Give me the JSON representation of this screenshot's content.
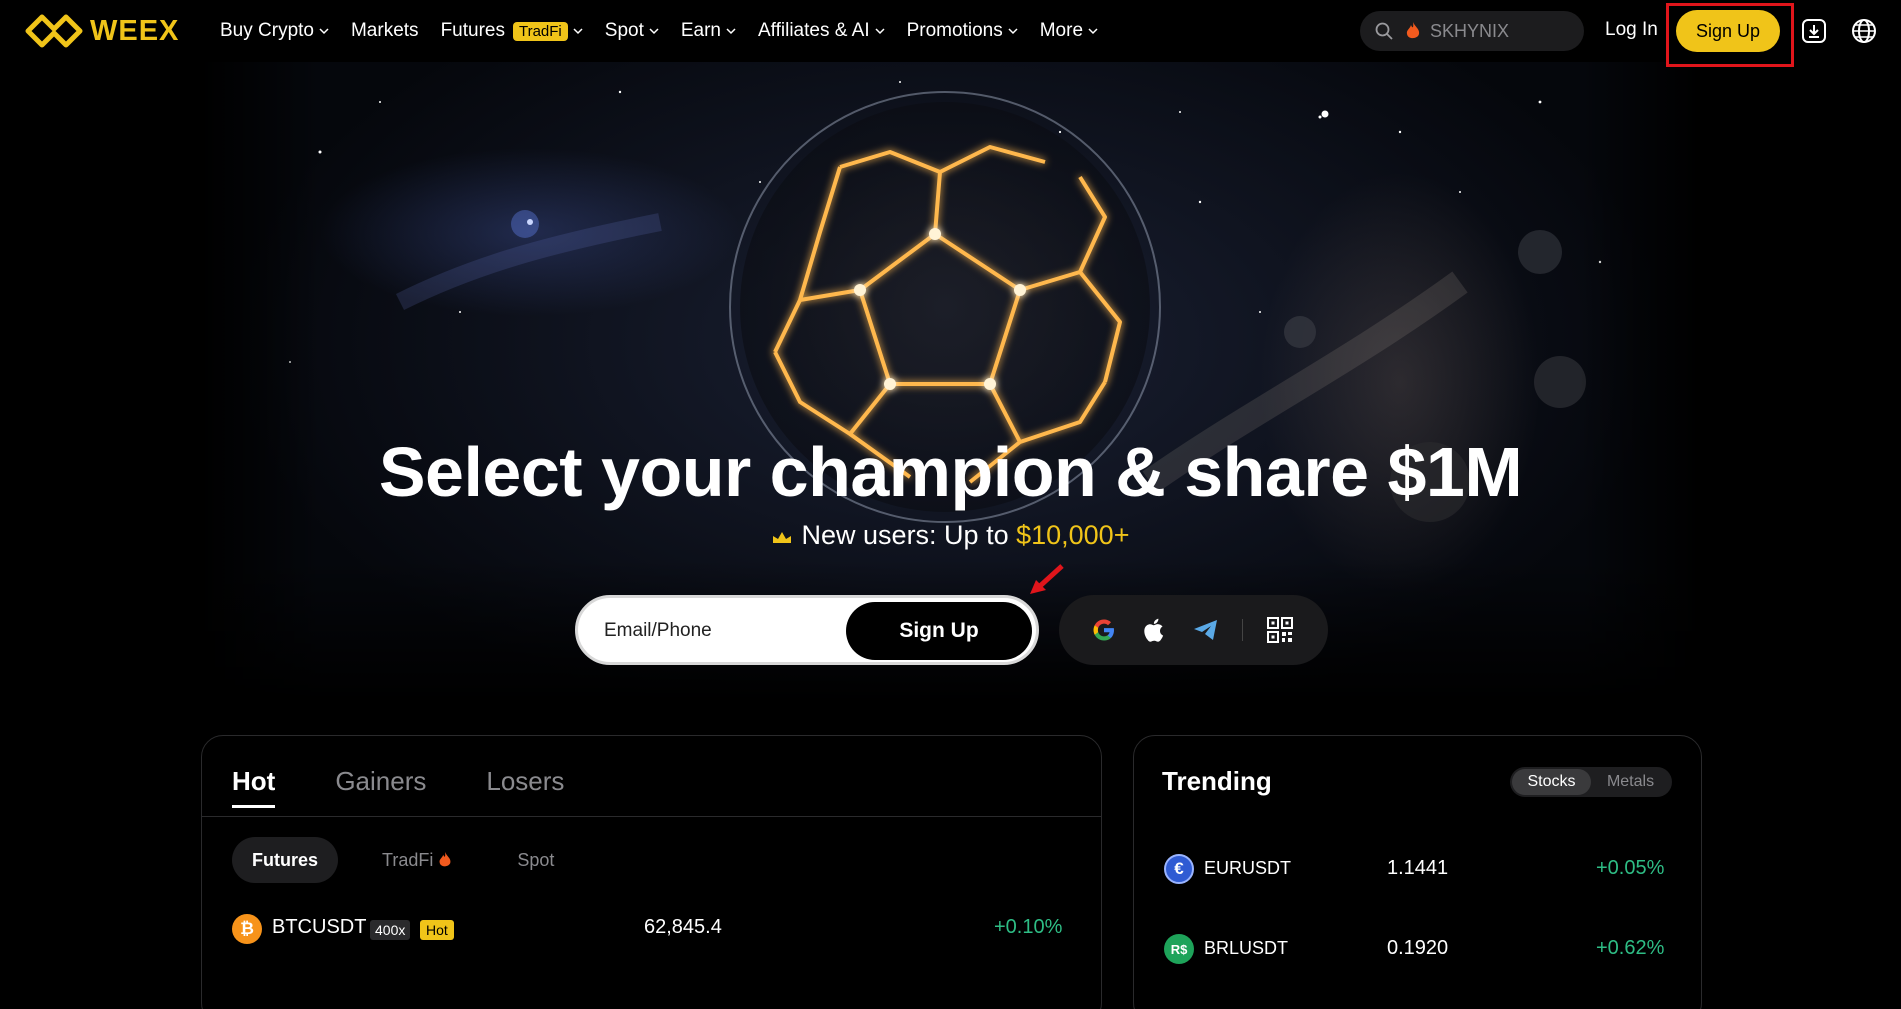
{
  "brand": {
    "name": "WEEX"
  },
  "nav": {
    "items": [
      {
        "label": "Buy Crypto",
        "dropdown": true
      },
      {
        "label": "Markets",
        "dropdown": false
      },
      {
        "label": "Futures",
        "badge": "TradFi",
        "dropdown": true
      },
      {
        "label": "Spot",
        "dropdown": true
      },
      {
        "label": "Earn",
        "dropdown": true
      },
      {
        "label": "Affiliates & AI",
        "dropdown": true
      },
      {
        "label": "Promotions",
        "dropdown": true
      },
      {
        "label": "More",
        "dropdown": true
      }
    ],
    "search_placeholder": "SKHYNIX",
    "login_label": "Log In",
    "signup_label": "Sign Up"
  },
  "hero": {
    "headline": "Select your champion & share $1M",
    "subline_prefix": "New users: Up to ",
    "subline_amount": "$10,000+",
    "email_placeholder": "Email/Phone",
    "signup_label": "Sign Up",
    "social_icons": [
      "google-icon",
      "apple-icon",
      "telegram-icon",
      "qr-code-icon"
    ]
  },
  "market": {
    "tabs": [
      "Hot",
      "Gainers",
      "Losers"
    ],
    "active_tab": "Hot",
    "chips": [
      "Futures",
      "TradFi",
      "Spot"
    ],
    "active_chip": "Futures",
    "rows": [
      {
        "pair": "BTCUSDT",
        "leverage": "400x",
        "tag": "Hot",
        "price": "62,845.4",
        "change": "+0.10%"
      }
    ]
  },
  "trending": {
    "title": "Trending",
    "segments": [
      "Stocks",
      "Metals"
    ],
    "active_segment": "Stocks",
    "rows": [
      {
        "pair": "EURUSDT",
        "icon_glyph": "€",
        "price": "1.1441",
        "change": "+0.05%"
      },
      {
        "pair": "BRLUSDT",
        "icon_glyph": "R$",
        "price": "0.1920",
        "change": "+0.62%"
      }
    ]
  },
  "colors": {
    "brand_yellow": "#f0c419",
    "positive": "#2ebd85",
    "highlight_red": "#e0151b"
  }
}
